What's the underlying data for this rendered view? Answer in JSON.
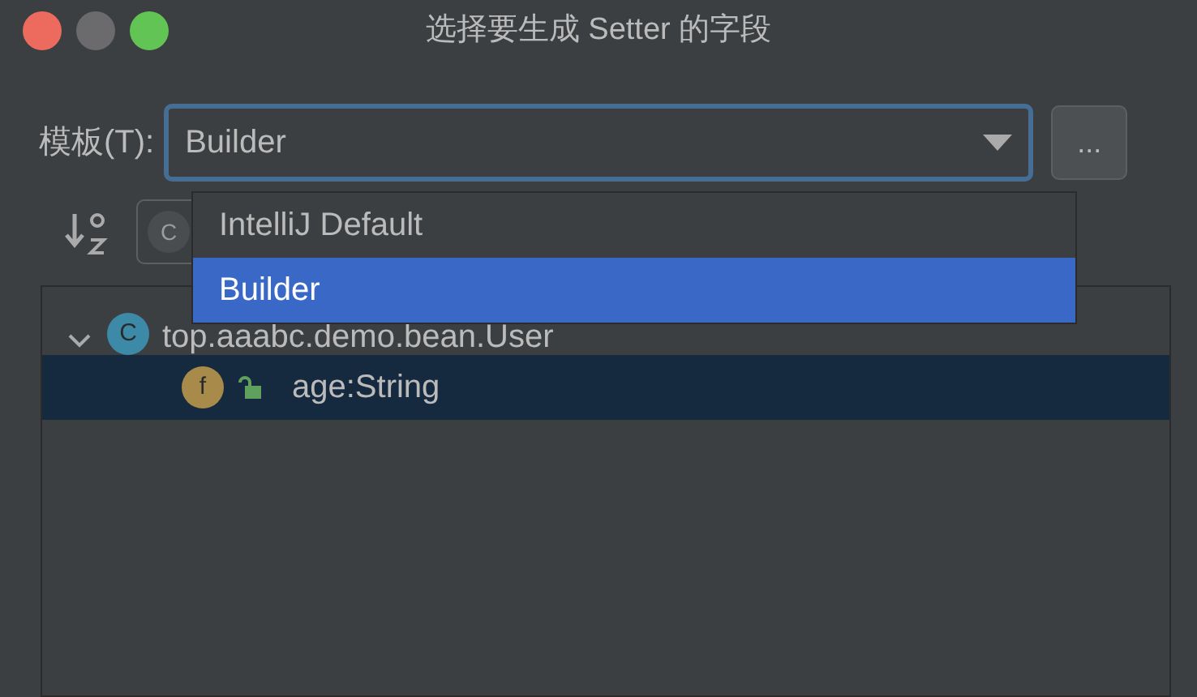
{
  "window": {
    "title": "选择要生成 Setter 的字段"
  },
  "template": {
    "label": "模板(T):",
    "value": "Builder",
    "more_button": "...",
    "dropdown": [
      {
        "label": "IntelliJ Default",
        "selected": false
      },
      {
        "label": "Builder",
        "selected": true
      }
    ]
  },
  "toolbar": {
    "filter_letter": "C"
  },
  "tree": [
    {
      "icon_letter": "C",
      "label": "top.aaabc.demo.bean.User",
      "expanded": true,
      "selected": false,
      "children": [
        {
          "icon_letter": "f",
          "label": "age:String",
          "selected": true
        }
      ]
    }
  ]
}
